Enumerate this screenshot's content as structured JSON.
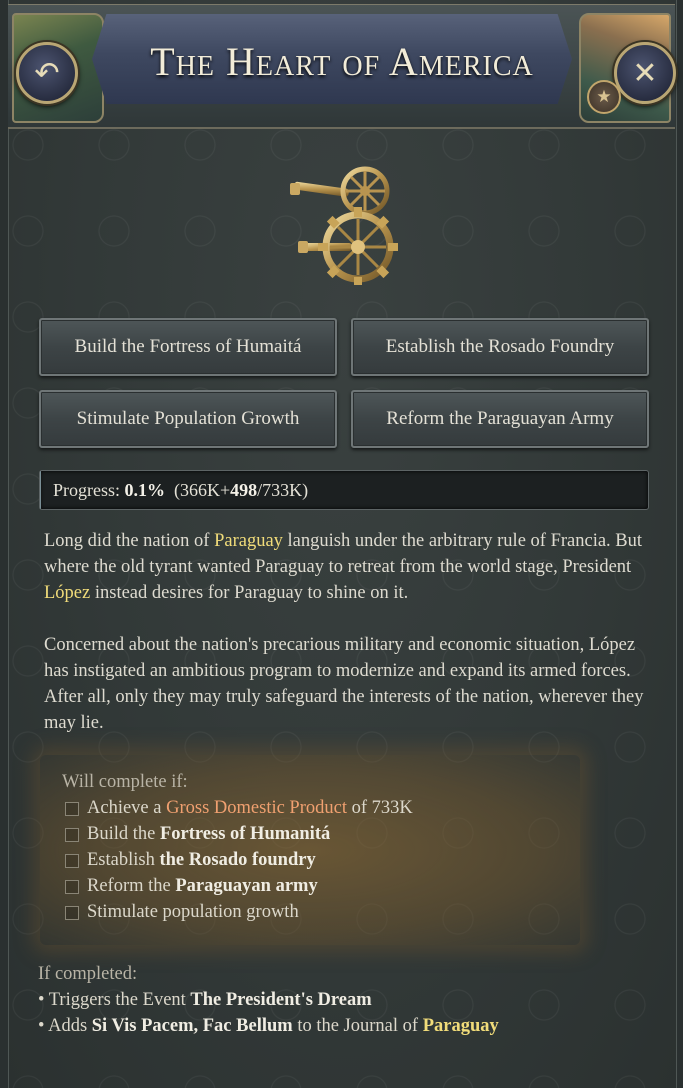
{
  "header": {
    "title": "The Heart of America",
    "back_icon": "↶",
    "close_icon": "✕",
    "star_icon": "★"
  },
  "actions": [
    {
      "label": "Build the Fortress of Humaitá"
    },
    {
      "label": "Establish the Rosado Foundry"
    },
    {
      "label": "Stimulate Population Growth"
    },
    {
      "label": "Reform the Paraguayan Army"
    }
  ],
  "progress": {
    "label": "Progress:",
    "percent": "0.1%",
    "current_prefix": "(366K+",
    "increment": "498",
    "target_suffix": "/733K)",
    "fraction": 0.001
  },
  "description": {
    "p1_a": "Long did the nation of ",
    "p1_country": "Paraguay",
    "p1_b": " languish under the arbitrary rule of Francia. But where the old tyrant wanted Paraguay to retreat from the world stage, President ",
    "p1_president": "López",
    "p1_c": " instead desires for Paraguay to shine on it.",
    "p2": "Concerned about the nation's precarious military and economic situation, López has instigated an ambitious program to modernize and expand its armed forces. After all, only they may truly safeguard the interests of the nation, wherever they may lie."
  },
  "requirements": {
    "title": "Will complete if:",
    "r1_a": "Achieve a ",
    "r1_link": "Gross Domestic Product",
    "r1_b": " of 733K",
    "r2_a": "Build the ",
    "r2_b": "Fortress of Humanitá",
    "r3_a": "Establish ",
    "r3_b": "the Rosado foundry",
    "r4_a": "Reform the ",
    "r4_b": "Paraguayan army",
    "r5": "Stimulate population growth"
  },
  "effects": {
    "title": "If completed:",
    "e1_a": "• Triggers the Event ",
    "e1_b": "The President's Dream",
    "e2_a": "• Adds ",
    "e2_b": "Si Vis Pacem, Fac Bellum",
    "e2_c": " to the Journal of ",
    "e2_d": "Paraguay"
  },
  "colors": {
    "highlight_yellow": "#f1dc7a",
    "link_orange": "#f0a070",
    "panel_bg": "#323938"
  }
}
